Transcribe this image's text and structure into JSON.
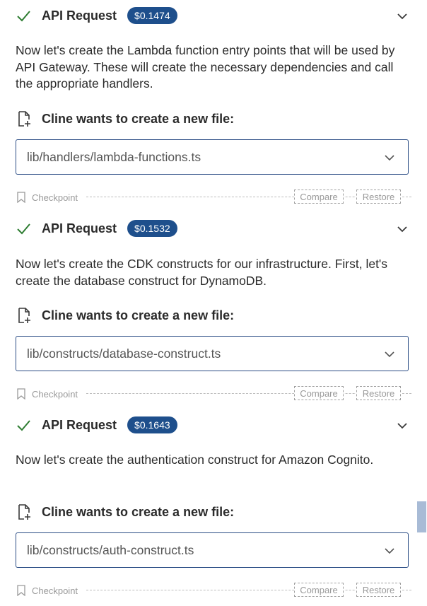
{
  "blocks": [
    {
      "api_title": "API Request",
      "cost": "$0.1474",
      "message": "Now let's create the Lambda function entry points that will be used by API Gateway. These will create the necessary dependencies and call the appropriate handlers.",
      "cline_title": "Cline wants to create a new file:",
      "file_path": "lib/handlers/lambda-functions.ts",
      "checkpoint": {
        "label": "Checkpoint",
        "compare": "Compare",
        "restore": "Restore"
      }
    },
    {
      "api_title": "API Request",
      "cost": "$0.1532",
      "message": "Now let's create the CDK constructs for our infrastructure. First, let's create the database construct for DynamoDB.",
      "cline_title": "Cline wants to create a new file:",
      "file_path": "lib/constructs/database-construct.ts",
      "checkpoint": {
        "label": "Checkpoint",
        "compare": "Compare",
        "restore": "Restore"
      }
    },
    {
      "api_title": "API Request",
      "cost": "$0.1643",
      "message": "Now let's create the authentication construct for Amazon Cognito.",
      "cline_title": "Cline wants to create a new file:",
      "file_path": "lib/constructs/auth-construct.ts",
      "checkpoint": {
        "label": "Checkpoint",
        "compare": "Compare",
        "restore": "Restore"
      }
    }
  ],
  "colors": {
    "accent": "#1e4f8c",
    "check": "#2e7d32",
    "border": "#2b4d85"
  },
  "icons": [
    "check-icon",
    "chevron-down-icon",
    "file-plus-icon",
    "bookmark-icon"
  ]
}
